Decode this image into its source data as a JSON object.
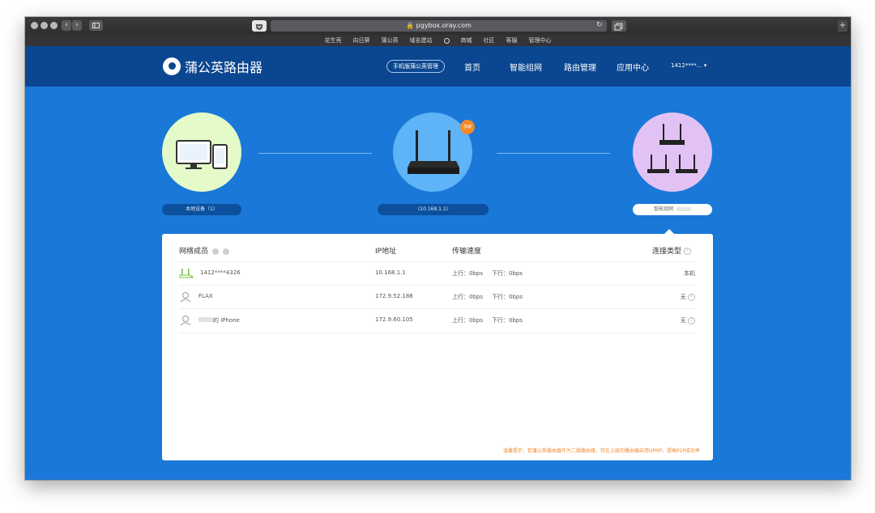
{
  "browser": {
    "url": "pgybox.oray.com",
    "bookmarks": [
      "花生壳",
      "向日葵",
      "蒲公英",
      "域名建站",
      "商城",
      "社区",
      "客服",
      "管理中心"
    ],
    "plus": "+"
  },
  "header": {
    "brand": "蒲公英路由器",
    "mobile_btn": "手机版蒲公英管理",
    "nav": [
      "首页",
      "智能组网",
      "路由管理",
      "应用中心"
    ],
    "user": "1412****... ▾"
  },
  "topology": {
    "local_label": "本地设备（1）",
    "router_label": "(10.168.1.1)",
    "router_badge": "加速",
    "network_label": "智能组网"
  },
  "table": {
    "headers": {
      "member": "网络成员",
      "ip": "IP地址",
      "speed": "传输速度",
      "conn": "连接类型"
    },
    "rows": [
      {
        "name": "1412****4326",
        "ip": "10.168.1.1",
        "up": "上行：0bps",
        "down": "下行：0bps",
        "type": "本机"
      },
      {
        "name": "FLAX",
        "ip": "172.9.52.188",
        "up": "上行：0bps",
        "down": "下行：0bps",
        "type": "无"
      },
      {
        "name": "的 iPhone",
        "ip": "172.9.60.105",
        "up": "上行：0bps",
        "down": "下行：0bps",
        "type": "无"
      }
    ],
    "tip": "温馨提示：若蒲公英路由器作为二级路由器，可在上层的路由器启用UPNP，提高P2P成功率"
  },
  "colors": {
    "page_bg": "#1a78d8",
    "header_bg": "#0b4690",
    "accent_orange": "#f08a2a"
  }
}
